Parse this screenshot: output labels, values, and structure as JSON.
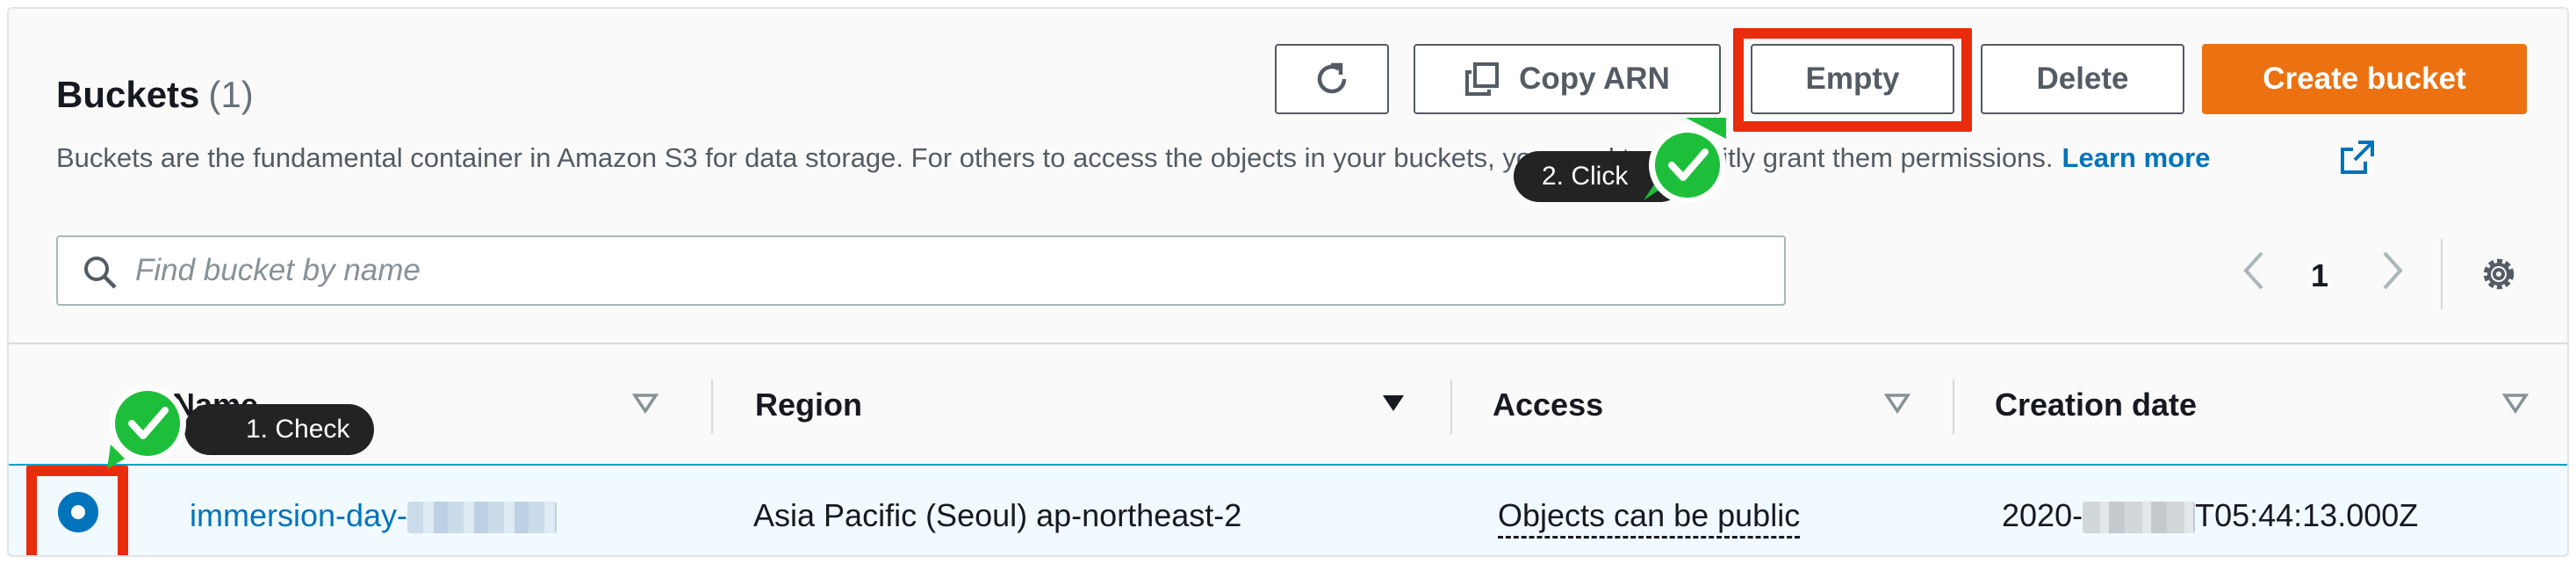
{
  "header": {
    "title": "Buckets",
    "count": "(1)",
    "description": "Buckets are the fundamental container in Amazon S3 for data storage. For others to access the objects in your buckets, you need to explicitly grant them permissions.",
    "learn_more": "Learn more"
  },
  "toolbar": {
    "copy_arn_label": "Copy ARN",
    "empty_label": "Empty",
    "delete_label": "Delete",
    "create_label": "Create bucket"
  },
  "search": {
    "placeholder": "Find bucket by name",
    "value": ""
  },
  "pagination": {
    "current_page": "1"
  },
  "table": {
    "columns": [
      "Name",
      "Region",
      "Access",
      "Creation date"
    ],
    "rows": [
      {
        "name": "immersion-day-",
        "region": "Asia Pacific (Seoul) ap-northeast-2",
        "access": "Objects can be public",
        "creation_date_prefix": "2020-",
        "creation_date_suffix": "T05:44:13.000Z",
        "selected": true
      }
    ]
  },
  "annotations": {
    "step1": "1. Check",
    "step2": "2. Click"
  },
  "colors": {
    "primary": "#ec7211",
    "link": "#0073bb",
    "highlight": "#e82c0c",
    "check": "#1dbf3a",
    "selected_row": "#f1faff"
  },
  "icons": [
    "refresh-icon",
    "copy-icon",
    "external-link-icon",
    "search-icon",
    "chevron-left-icon",
    "chevron-right-icon",
    "gear-icon",
    "sort-icon",
    "check-icon"
  ]
}
